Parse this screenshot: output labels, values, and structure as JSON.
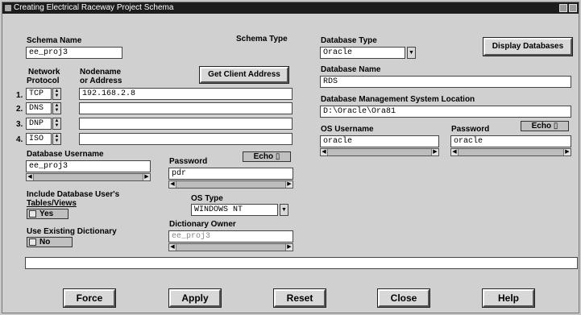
{
  "window": {
    "title": "Creating Electrical Raceway Project Schema"
  },
  "schema": {
    "name_label": "Schema Name",
    "name_value": "ee_proj3",
    "type_label": "Schema Type"
  },
  "network": {
    "protocol_label_1": "Network",
    "protocol_label_2": "Protocol",
    "node_label_1": "Nodename",
    "node_label_2": "or Address",
    "get_client_button": "Get Client Address",
    "rows": [
      {
        "num": "1.",
        "protocol": "TCP",
        "address": "192.168.2.8"
      },
      {
        "num": "2.",
        "protocol": "DNS",
        "address": ""
      },
      {
        "num": "3.",
        "protocol": "DNP",
        "address": ""
      },
      {
        "num": "4.",
        "protocol": "ISO",
        "address": ""
      }
    ]
  },
  "db_user": {
    "label": "Database Username",
    "value": "ee_proj3"
  },
  "password_left": {
    "label": "Password",
    "value": "pdr",
    "echo_label": "Echo"
  },
  "include_views": {
    "label_1": "Include Database User's",
    "label_2": "Tables/Views",
    "value": "Yes"
  },
  "os_type": {
    "label": "OS Type",
    "value": "WINDOWS NT"
  },
  "existing_dict": {
    "label": "Use Existing Dictionary",
    "value": "No"
  },
  "dict_owner": {
    "label": "Dictionary Owner",
    "value": "ee_proj3"
  },
  "right": {
    "db_type_label": "Database Type",
    "db_type_value": "Oracle",
    "display_db_button": "Display Databases",
    "db_name_label": "Database Name",
    "db_name_value": "RDS",
    "dbms_loc_label": "Database Management System Location",
    "dbms_loc_value": "D:\\Oracle\\Ora81",
    "os_user_label": "OS Username",
    "os_user_value": "oracle",
    "password_label": "Password",
    "password_value": "oracle",
    "echo_label": "Echo"
  },
  "buttons": {
    "force": "Force",
    "apply": "Apply",
    "reset": "Reset",
    "close": "Close",
    "help": "Help"
  },
  "icons": {
    "window_menu": "app-menu-icon",
    "spin": "spinner-arrows-icon",
    "dropdown": "dropdown-arrow-icon"
  }
}
